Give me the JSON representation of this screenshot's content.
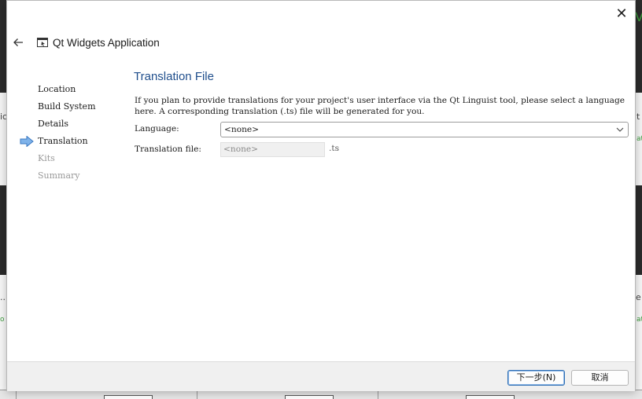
{
  "background": {
    "fragments": [
      "ic",
      "t",
      "...",
      "e",
      "o",
      "at",
      "at",
      "Vi"
    ]
  },
  "dialog": {
    "title": "Qt Widgets Application",
    "close_glyph": "✕",
    "icons": {
      "back": "arrow-left-icon",
      "app": "application-window-icon",
      "current_step": "current-step-arrow-icon",
      "dropdown": "chevron-down-icon"
    },
    "steps": [
      {
        "label": "Location",
        "state": "done"
      },
      {
        "label": "Build System",
        "state": "done"
      },
      {
        "label": "Details",
        "state": "done"
      },
      {
        "label": "Translation",
        "state": "current"
      },
      {
        "label": "Kits",
        "state": "pending"
      },
      {
        "label": "Summary",
        "state": "pending"
      }
    ],
    "page": {
      "title": "Translation File",
      "description": "If you plan to provide translations for your project's user interface via the Qt Linguist tool, please select a language here. A corresponding translation (.ts) file will be generated for you.",
      "language_label": "Language:",
      "language_value": "<none>",
      "translation_file_label": "Translation file:",
      "translation_file_value": "<none>",
      "translation_file_ext": ".ts"
    },
    "footer": {
      "next_label": "下一步(N)",
      "cancel_label": "取消"
    }
  },
  "colors": {
    "accent": "#1f4e8c",
    "arrow": "#4a90d9",
    "disabled_text": "#9a9a9a"
  }
}
